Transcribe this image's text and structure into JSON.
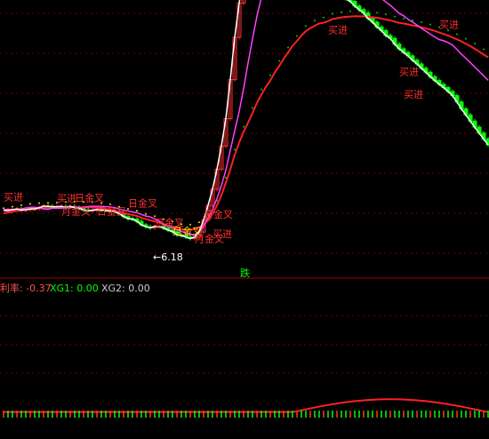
{
  "main_panel": {
    "signal_labels": [
      {
        "text": "买进",
        "price": 28.5,
        "bar": 0,
        "color": "#ff3030"
      },
      {
        "text": "买进",
        "price": 27.7,
        "bar": 12,
        "color": "#ff3030"
      },
      {
        "text": "月金叉",
        "price": 20.3,
        "bar": 13,
        "color": "#ff3030"
      },
      {
        "text": "日金叉",
        "price": 20.3,
        "bar": 21,
        "color": "#ff3030"
      },
      {
        "text": "日金叉",
        "price": 27.9,
        "bar": 16,
        "color": "#ff3030"
      },
      {
        "text": "日金叉",
        "price": 13.6,
        "bar": 34,
        "color": "#ff3030"
      },
      {
        "text": "日金叉",
        "price": 24.8,
        "bar": 28,
        "color": "#ff3030"
      },
      {
        "text": "月金叉",
        "price": 8.6,
        "bar": 38,
        "color": "#ffd700"
      },
      {
        "text": "月金叉",
        "price": 4.2,
        "bar": 43,
        "color": "#ff3030"
      },
      {
        "text": "日金叉",
        "price": 18.3,
        "bar": 45,
        "color": "#ff3030"
      },
      {
        "text": "买进",
        "price": 7.1,
        "bar": 47,
        "color": "#ff3030"
      },
      {
        "text": "买进",
        "price": 125.6,
        "bar": 73,
        "color": "#ff3030"
      },
      {
        "text": "买进",
        "price": 128.6,
        "bar": 98,
        "color": "#ff3030"
      },
      {
        "text": "买进",
        "price": 101.3,
        "bar": 89,
        "color": "#ff3030"
      },
      {
        "text": "买进",
        "price": 88.1,
        "bar": 90,
        "color": "#ff3030"
      }
    ],
    "low_annotation": "←6.18",
    "down_marker": "跌"
  },
  "indicator_header": {
    "label1": "利率: -0.37",
    "label2": "XG1: 0.00",
    "label3": "XG2: 0.00"
  },
  "chart_data": {
    "type": "line",
    "title": "",
    "xlabel": "",
    "ylabel": "",
    "price_axis": {
      "ylim": [
        -10,
        145
      ]
    },
    "x": [
      0,
      1,
      2,
      3,
      4,
      5,
      6,
      7,
      8,
      9,
      10,
      11,
      12,
      13,
      14,
      15,
      16,
      17,
      18,
      19,
      20,
      21,
      22,
      23,
      24,
      25,
      26,
      27,
      28,
      29,
      30,
      31,
      32,
      33,
      34,
      35,
      36,
      37,
      38,
      39,
      40,
      41,
      42,
      43,
      44,
      45,
      46,
      47,
      48,
      49,
      50,
      51,
      52,
      53,
      54,
      55,
      56,
      57,
      58,
      59,
      60,
      61,
      62,
      63,
      64,
      65,
      66,
      67,
      68,
      69,
      70,
      71,
      72,
      73,
      74,
      75,
      76,
      77,
      78,
      79,
      80,
      81,
      82,
      83,
      84,
      85,
      86,
      87,
      88,
      89,
      90,
      91,
      92,
      93,
      94,
      95,
      96,
      97,
      98,
      99,
      100,
      101,
      102,
      103,
      104,
      105,
      106,
      107,
      108,
      109
    ],
    "series": [
      {
        "values": [
          21,
          21.4,
          21.9,
          22.4,
          22.7,
          23,
          23.5,
          23.6,
          23.9,
          24.2,
          24.1,
          24.2,
          24.2,
          24.4,
          24.5,
          24.6,
          24.8,
          24.3,
          24.6,
          24.6,
          24.5,
          24.2,
          23.9,
          23.5,
          23.2,
          22.5,
          21.8,
          21.2,
          20.6,
          20,
          19.5,
          18.3,
          17.6,
          16.9,
          16.3,
          15.5,
          14.6,
          13.9,
          13.3,
          12.6,
          11.7,
          11.2,
          11.4,
          11.9,
          12.8,
          14.3,
          17.1,
          20.7,
          25.5,
          31.4,
          38.7,
          46.5,
          55,
          62.1,
          68.3,
          73.7,
          79.3,
          85.2,
          90,
          94.5,
          98.2,
          102.8,
          106.6,
          110.8,
          114.4,
          118.4,
          121.1,
          124.3,
          126.9,
          128.6,
          130.1,
          131.3,
          131.8,
          132.7,
          133.9,
          134.4,
          134.9,
          135.2,
          135.4,
          135.6,
          135.5,
          135.5,
          135.2,
          134.9,
          134.6,
          134.2,
          133.6,
          133.2,
          132.4,
          131.7,
          131.3,
          130.8,
          130.2,
          129.8,
          129.1,
          128.5,
          127.8,
          127.1,
          126.1,
          125.2,
          124.3,
          123.2,
          122.1,
          120.9,
          119.5,
          118.2,
          116.6,
          115,
          113.3,
          111.6
        ]
      },
      {
        "values": [
          23.2,
          23.3,
          23.1,
          23.4,
          23.5,
          24.1,
          24.4,
          24.5,
          24.2,
          23.5,
          23.3,
          23.9,
          23.9,
          24,
          24.1,
          24.2,
          24.6,
          24.4,
          24.2,
          24.9,
          25.1,
          25.1,
          25.1,
          24.8,
          24.7,
          24.3,
          23.5,
          22.7,
          22.4,
          21.8,
          21.4,
          20.3,
          19.4,
          18.9,
          17.7,
          16.5,
          14.8,
          13.4,
          12.4,
          11.4,
          10.5,
          9.5,
          9,
          8.5,
          10,
          13.4,
          18.4,
          23.1,
          29.5,
          37,
          46,
          57.6,
          68.9,
          80.1,
          93.5,
          108.4,
          122.4,
          135.6,
          146.5,
          153,
          157.4,
          160.7,
          162.8,
          163.6,
          163.8,
          164.4,
          164.2,
          163.4,
          162.9,
          162.1,
          162.2,
          161.5,
          160.8,
          159.9,
          158.6,
          157.3,
          156,
          154.5,
          153.8,
          152.5,
          151.4,
          150.7,
          149.3,
          148.8,
          146.9,
          145.9,
          143.8,
          141.9,
          139.6,
          137.2,
          135.8,
          133.8,
          132.2,
          130.4,
          128.5,
          126.9,
          125.1,
          123.5,
          122,
          121.3,
          120.3,
          118.8,
          116.2,
          113.5,
          111.1,
          108.6,
          106,
          103.5,
          100.9,
          98.3
        ]
      },
      {
        "values": [
          22.6,
          22.7,
          23.1,
          23.5,
          22.9,
          23.1,
          23.5,
          23.6,
          24.2,
          25.2,
          25,
          24.8,
          24.8,
          25,
          24.5,
          25,
          24.3,
          23.8,
          22.9,
          22.5,
          22.8,
          23.2,
          22.8,
          22.7,
          22.3,
          22,
          20.8,
          19.1,
          17.9,
          17.6,
          16.3,
          14.3,
          13.2,
          12.5,
          13.4,
          13.4,
          12.4,
          11.2,
          10.3,
          8.5,
          8,
          7.2,
          6.3,
          7.1,
          10.1,
          17.1,
          25.6,
          35,
          46.6,
          60.1,
          76,
          98.7,
          123.3,
          143.2,
          158.4,
          166,
          172.3,
          175.5,
          178.6,
          177.4,
          178,
          177.6,
          176.9,
          174.9,
          172.9,
          172.2,
          170.1,
          167.5,
          164.8,
          164.1,
          163.6,
          161.2,
          159.3,
          156.4,
          154,
          151.3,
          147.7,
          145.6,
          144.2,
          141.5,
          139.4,
          137.4,
          134.3,
          132.1,
          129.3,
          127.2,
          124.4,
          122.7,
          119.3,
          116.6,
          114.5,
          112.5,
          110,
          107.8,
          105.3,
          103,
          100.4,
          98.2,
          96,
          94.1,
          91.8,
          89.4,
          85.7,
          81.7,
          78.2,
          74.6,
          71.1,
          67.6,
          64.2,
          60.8
        ]
      }
    ],
    "indicator_series": [
      {
        "values": [
          0.0,
          0.0,
          0.0,
          0.0,
          0.0,
          0.0,
          0.0,
          0.0,
          0.0,
          0.0,
          0.0,
          0.0,
          0.0,
          0.0,
          0.0,
          0.0,
          0.0,
          0.0,
          0.0,
          0.0,
          0.0,
          0.0,
          0.0,
          0.0,
          0.0,
          0.0,
          0.0,
          0.0,
          0.0,
          0.0,
          0.0,
          0.0,
          0.0,
          0.0,
          0.0,
          0.0,
          0.0,
          0.0,
          0.0,
          0.0,
          0.0,
          0.0,
          0.0,
          0.0,
          0.0,
          0.0,
          0.0,
          0.0,
          0.0,
          0.0,
          0.0,
          0.0,
          0.0,
          0.0,
          0.0,
          0.0,
          0.0,
          0.0,
          0.0,
          0.0,
          0.0,
          0.0,
          0.0,
          0.0,
          0.0,
          0.0,
          0.6,
          1.5,
          2.3,
          3.1,
          3.9,
          4.7,
          5.4,
          6.1,
          6.8,
          7.4,
          8.0,
          8.5,
          9.0,
          9.5,
          9.8,
          10.2,
          10.5,
          10.7,
          10.9,
          11.0,
          11.1,
          11.1,
          11.1,
          11.0,
          10.9,
          10.7,
          10.5,
          10.2,
          9.8,
          9.5,
          9.0,
          8.5,
          8.0,
          7.4,
          6.8,
          6.1,
          5.4,
          4.7,
          3.9,
          3.1,
          2.3,
          1.5,
          0.6,
          0.0
        ]
      }
    ],
    "indicator_axis": {
      "ylim": [
        -5,
        100
      ]
    }
  }
}
